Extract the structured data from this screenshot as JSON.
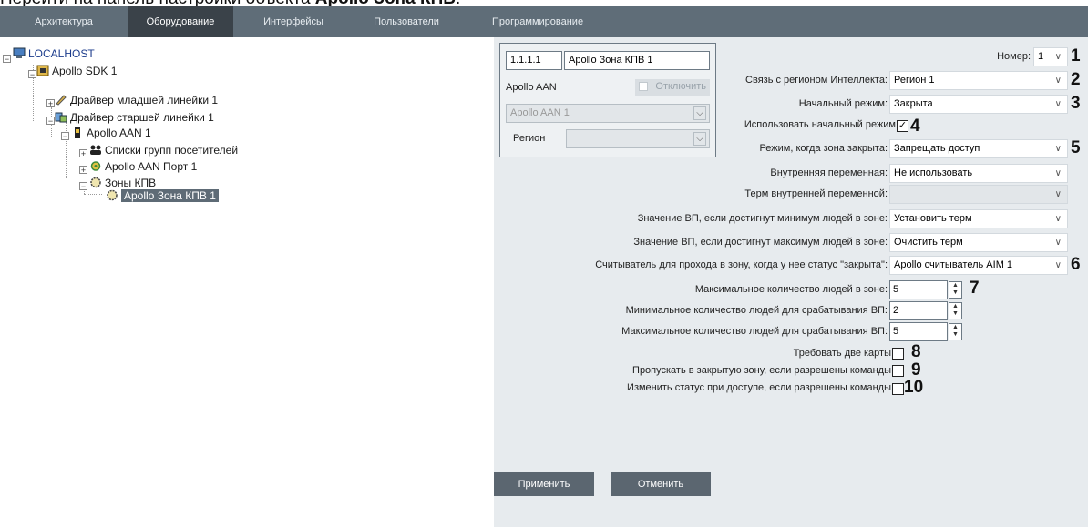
{
  "caption": {
    "prefix": "Перейти на панель настройки объекта ",
    "object": "Apollo Зона КПВ",
    "suffix": "."
  },
  "tabs": [
    "Архитектура",
    "Оборудование",
    "Интерфейсы",
    "Пользователи",
    "Программирование"
  ],
  "active_tab": "Оборудование",
  "tree": [
    {
      "label": "LOCALHOST",
      "icon": "computer-icon"
    },
    {
      "label": "Apollo SDK 1",
      "icon": "sdk-icon"
    },
    {
      "label": "Драйвер младшей линейки 1",
      "icon": "driver-icon"
    },
    {
      "label": "Драйвер старшей линейки  1",
      "icon": "driver-senior-icon"
    },
    {
      "label": "Apollo AAN 1",
      "icon": "controller-icon"
    },
    {
      "label": "Списки групп посетителей",
      "icon": "group-icon"
    },
    {
      "label": "Apollo AAN Порт 1",
      "icon": "port-icon"
    },
    {
      "label": "Зоны КПВ",
      "icon": "zone-icon"
    },
    {
      "label": "Apollo Зона КПВ 1",
      "icon": "zone-icon"
    }
  ],
  "card": {
    "id_value": "1.1.1.1",
    "name_value": "Apollo Зона КПВ 1",
    "parent_label": "Apollo AAN",
    "disable_label": "Отключить",
    "parent_select": "Apollo AAN 1",
    "region_label": "Регион",
    "region_select": ""
  },
  "fields": {
    "number_label": "Номер:",
    "number_value": "1",
    "region_link_label": "Связь с регионом Интеллекта:",
    "region_link_value": "Регион 1",
    "initial_mode_label": "Начальный режим:",
    "initial_mode_value": "Закрыта",
    "use_initial_mode_label": "Использовать начальный режим",
    "closed_mode_label": "Режим, когда зона закрыта:",
    "closed_mode_value": "Запрещать доступ",
    "internal_var_label": "Внутренняя переменная:",
    "internal_var_value": "Не использовать",
    "internal_term_label": "Терм внутренней переменной:",
    "internal_term_value": "",
    "min_people_label": "Значение ВП, если достигнут минимум людей в зоне:",
    "min_people_value": "Установить терм",
    "max_people_label": "Значение ВП, если достигнут максимум людей в зоне:",
    "max_people_value": "Очистить терм",
    "reader_label": "Считыватель для прохода в зону, когда у нее статус \"закрыта\":",
    "reader_value": "Apollo считыватель AIM 1",
    "max_in_zone_label": "Максимальное количество людей в зоне:",
    "max_in_zone_value": "5",
    "min_trigger_label": "Минимальное количество людей для срабатывания ВП:",
    "min_trigger_value": "2",
    "max_trigger_label": "Максимальное количество людей для срабатывания ВП:",
    "max_trigger_value": "5",
    "two_cards_label": "Требовать две карты",
    "pass_closed_label": "Пропускать в закрытую зону, если разрешены команды",
    "change_status_label": "Изменить статус при доступе, если разрешены команды"
  },
  "markers": [
    "1",
    "2",
    "3",
    "4",
    "5",
    "6",
    "7",
    "8",
    "9",
    "10"
  ],
  "buttons": {
    "apply": "Применить",
    "cancel": "Отменить"
  },
  "checks": {
    "use_initial_mode": true,
    "two_cards": false,
    "pass_closed": false,
    "change_status": false
  }
}
